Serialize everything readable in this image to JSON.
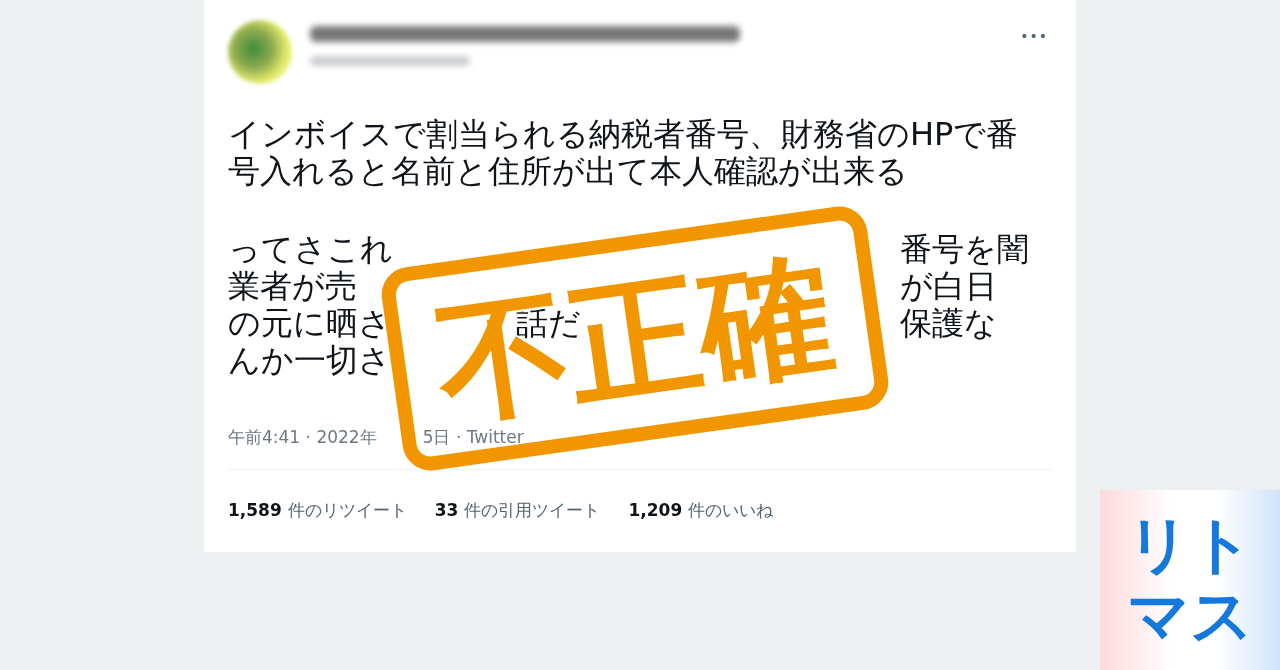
{
  "tweet": {
    "more": "•••",
    "paragraphs": [
      {
        "lines": [
          {
            "segments": [
              "インボイスで割当られる納税者番号、財務省のHPで番"
            ]
          },
          {
            "segments": [
              "号入れると名前と住所が出て本人確認が出来る"
            ]
          }
        ]
      },
      {
        "lines": [
          {
            "segments": [
              "ってさこれ",
              "番号を闇"
            ]
          },
          {
            "segments": [
              "業者が売",
              "が白日"
            ]
          },
          {
            "segments": [
              "の元に晒さ",
              "話だ",
              "保護な"
            ]
          },
          {
            "segments": [
              "んか一切さ"
            ]
          }
        ]
      }
    ],
    "footer": {
      "segments": [
        "午前4:41 · 2022年",
        "5日 · Twitter"
      ]
    },
    "stats": [
      {
        "count": "1,589",
        "label": "件のリツイート"
      },
      {
        "count": "33",
        "label": "件の引用ツイート"
      },
      {
        "count": "1,209",
        "label": "件のいいね"
      }
    ]
  },
  "stamp": {
    "text": "不正確"
  },
  "logo": {
    "text": "リトマス"
  }
}
